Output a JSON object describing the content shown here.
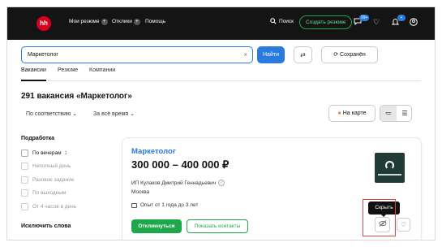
{
  "header": {
    "logo_text": "hh",
    "nav": [
      {
        "label": "Мои резюме",
        "plus": "+"
      },
      {
        "label": "Отклики",
        "plus": "+"
      },
      {
        "label": "Помощь"
      }
    ],
    "search_label": "Поиск",
    "create_resume": "Создать резюме",
    "chat_badge": "99+",
    "notif_badge": "+"
  },
  "search": {
    "value": "Маркетолог",
    "find_button": "Найти",
    "save_button": "Сохранён"
  },
  "tabs": [
    {
      "label": "Вакансии",
      "active": true
    },
    {
      "label": "Резюме"
    },
    {
      "label": "Компании"
    }
  ],
  "results": {
    "title": "291 вакансия «Маркетолог»",
    "sort": "По соответствию",
    "period": "За всё время",
    "map_button": "На карте"
  },
  "sidebar": {
    "title": "Подработка",
    "items": [
      {
        "label": "По вечерам",
        "count": "1"
      },
      {
        "label": "Неполный день"
      },
      {
        "label": "Разовое задание"
      },
      {
        "label": "По выходным"
      },
      {
        "label": "От 4 часов в день"
      }
    ],
    "exclude_title": "Исключить слова"
  },
  "vacancy": {
    "title": "Маркетолог",
    "salary": "300 000 – 400 000 ₽",
    "employer": "ИП Кулаков Дмитрий Геннадьевич",
    "city": "Москва",
    "experience": "Опыт от 1 года до 3 лет",
    "apply_button": "Откликнуться",
    "contacts_button": "Показать контакты",
    "hide_tooltip": "Скрыть"
  },
  "colors": {
    "brand_red": "#d6001c",
    "accent_blue": "#2b7bdf",
    "green": "#1fa84a",
    "highlight": "#e1473d"
  }
}
